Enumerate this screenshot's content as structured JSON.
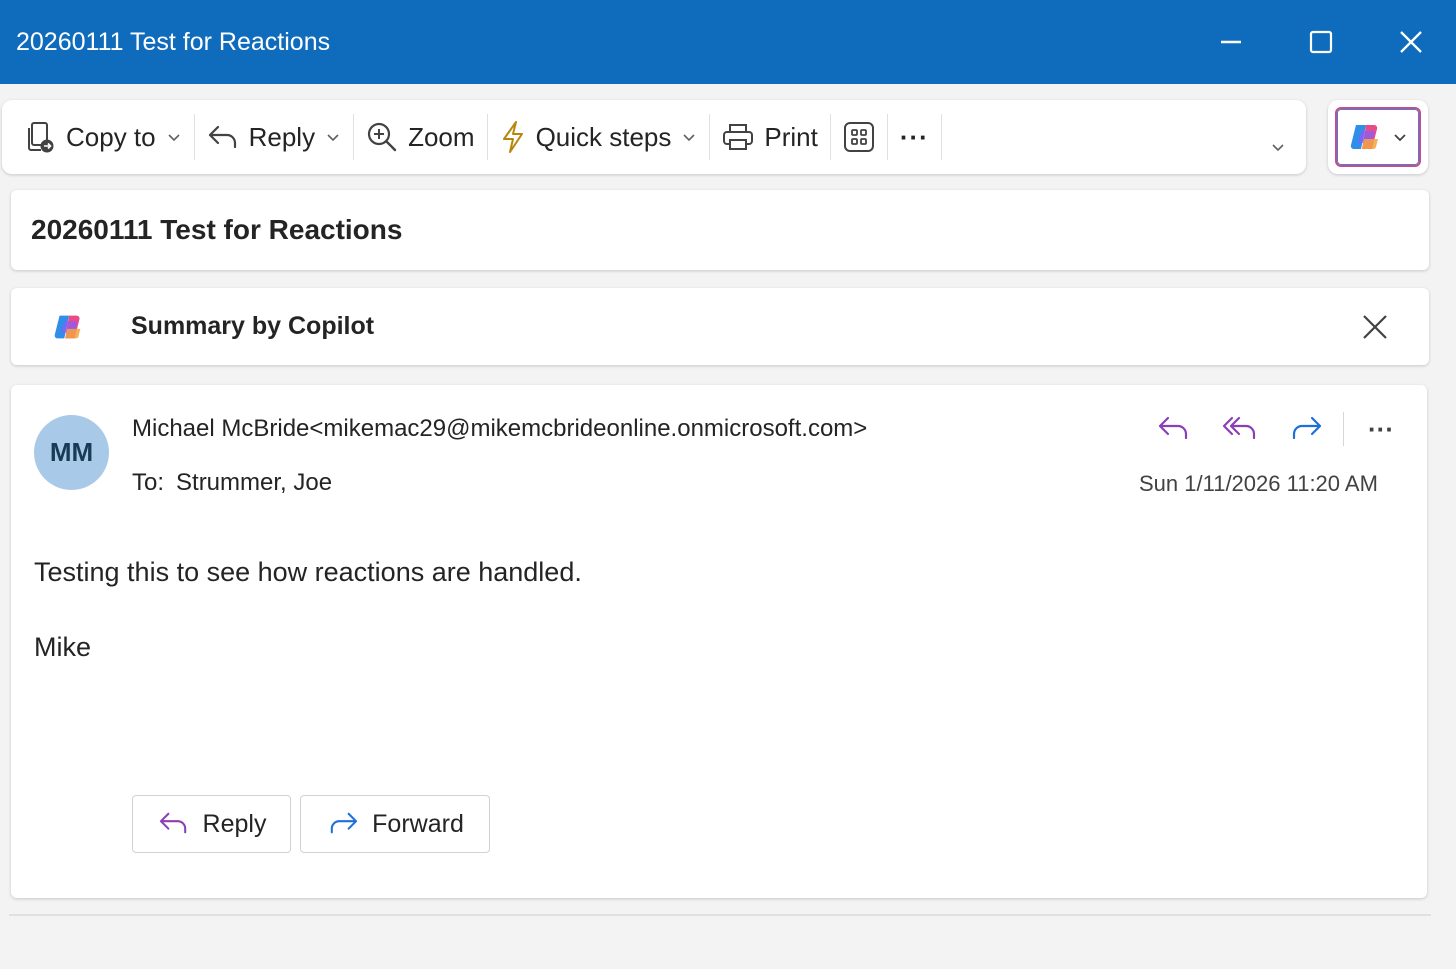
{
  "window": {
    "title": "20260111 Test for Reactions"
  },
  "toolbar": {
    "copy_to": "Copy to",
    "reply": "Reply",
    "zoom": "Zoom",
    "quick_steps": "Quick steps",
    "print": "Print",
    "more": "···"
  },
  "subject": "20260111 Test for Reactions",
  "summary": {
    "label": "Summary by Copilot"
  },
  "message": {
    "avatar_initials": "MM",
    "from": "Michael McBride<mikemac29@mikemcbrideonline.onmicrosoft.com>",
    "to_label": "To:",
    "to_value": "Strummer, Joe",
    "date": "Sun 1/11/2026 11:20 AM",
    "more": "···",
    "body": "Testing this to see how reactions are handled.",
    "signature": "Mike",
    "reply_button": "Reply",
    "forward_button": "Forward"
  },
  "colors": {
    "titlebar": "#0f6cbd",
    "reply_arrows": "#8a3fb5",
    "forward_arrow": "#1e6fd9",
    "avatar_bg": "#a9c9e8"
  }
}
